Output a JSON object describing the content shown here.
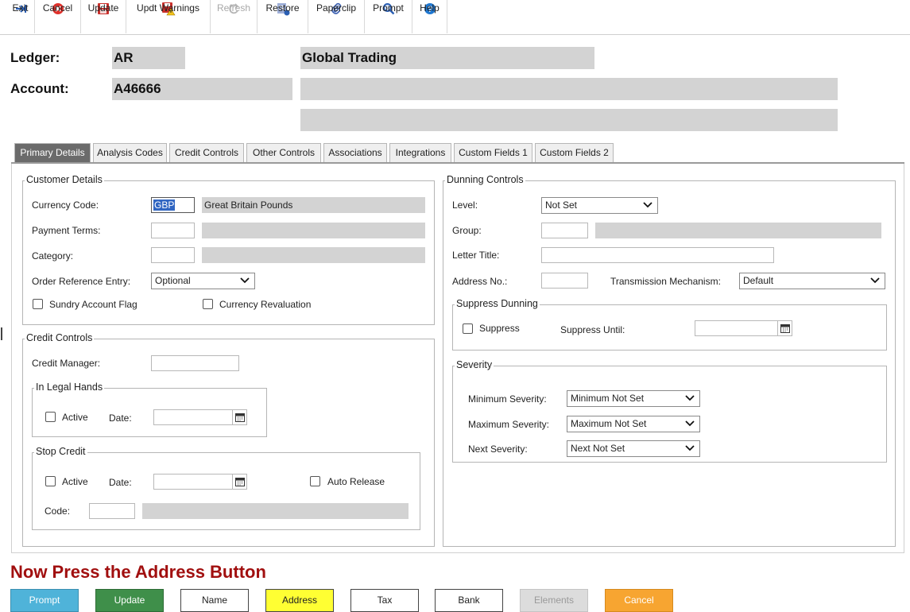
{
  "toolbar": {
    "exit": "Exit",
    "cancel": "Cancel",
    "update": "Update",
    "updt_warnings": "Updt Warnings",
    "refresh": "Refresh",
    "restore": "Restore",
    "paperclip": "Paperclip",
    "prompt": "Prompt",
    "help": "Help"
  },
  "header": {
    "ledger_label": "Ledger:",
    "ledger_value": "AR",
    "company_name": "Global Trading",
    "account_label": "Account:",
    "account_value": "A46666",
    "account_desc_1": "",
    "account_desc_2": ""
  },
  "tabs": [
    {
      "label": "Primary Details",
      "active": true
    },
    {
      "label": "Analysis Codes"
    },
    {
      "label": "Credit Controls"
    },
    {
      "label": "Other Controls"
    },
    {
      "label": "Associations"
    },
    {
      "label": "Integrations"
    },
    {
      "label": "Custom Fields 1"
    },
    {
      "label": "Custom Fields 2"
    }
  ],
  "customer_details": {
    "legend": "Customer Details",
    "currency_code_label": "Currency Code:",
    "currency_code_value": "GBP",
    "currency_desc": "Great Britain Pounds",
    "payment_terms_label": "Payment Terms:",
    "category_label": "Category:",
    "order_ref_label": "Order Reference Entry:",
    "order_ref_value": "Optional",
    "sundry_label": "Sundry Account Flag",
    "currency_reval_label": "Currency Revaluation"
  },
  "credit_controls": {
    "legend": "Credit Controls",
    "credit_manager_label": "Credit Manager:",
    "legal_legend": "In Legal Hands",
    "legal_active_label": "Active",
    "legal_date_label": "Date:",
    "stop_legend": "Stop Credit",
    "stop_active_label": "Active",
    "stop_date_label": "Date:",
    "auto_release_label": "Auto Release",
    "code_label": "Code:"
  },
  "dunning": {
    "legend": "Dunning Controls",
    "level_label": "Level:",
    "level_value": "Not Set",
    "group_label": "Group:",
    "letter_title_label": "Letter Title:",
    "address_no_label": "Address No.:",
    "transmission_label": "Transmission Mechanism:",
    "transmission_value": "Default",
    "suppress_legend": "Suppress Dunning",
    "suppress_label": "Suppress",
    "suppress_until_label": "Suppress Until:",
    "severity_legend": "Severity",
    "min_sev_label": "Minimum Severity:",
    "min_sev_value": "Minimum Not Set",
    "max_sev_label": "Maximum Severity:",
    "max_sev_value": "Maximum Not Set",
    "next_sev_label": "Next Severity:",
    "next_sev_value": "Next Not Set"
  },
  "footer": {
    "message": "Now Press the Address Button",
    "buttons": {
      "prompt": "Prompt",
      "update": "Update",
      "name": "Name",
      "address": "Address",
      "tax": "Tax",
      "bank": "Bank",
      "elements": "Elements",
      "cancel": "Cancel"
    }
  },
  "colors": {
    "tab_active_bg": "#6b6b6b",
    "message_red": "#a10f0f",
    "prompt_btn": "#4fb3d9",
    "update_btn": "#3f8f4a",
    "address_btn": "#ffff33",
    "cancel_btn": "#f7a531",
    "elements_btn": "#dcdcdc"
  }
}
